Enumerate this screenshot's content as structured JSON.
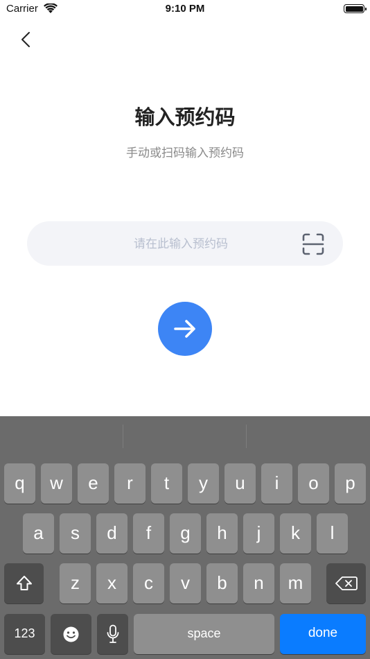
{
  "status_bar": {
    "carrier": "Carrier",
    "time": "9:10 PM"
  },
  "page": {
    "title": "输入预约码",
    "subtitle": "手动或扫码输入预约码",
    "input": {
      "value": "",
      "placeholder": "请在此输入预约码"
    }
  },
  "keyboard": {
    "row1": [
      "q",
      "w",
      "e",
      "r",
      "t",
      "y",
      "u",
      "i",
      "o",
      "p"
    ],
    "row2": [
      "a",
      "s",
      "d",
      "f",
      "g",
      "h",
      "j",
      "k",
      "l"
    ],
    "row3": [
      "z",
      "x",
      "c",
      "v",
      "b",
      "n",
      "m"
    ],
    "numbers_key": "123",
    "space_key": "space",
    "done_key": "done"
  },
  "icons": {
    "back": "chevron-left-icon",
    "scan": "scan-icon",
    "submit": "arrow-right-icon",
    "shift": "shift-icon",
    "delete": "delete-backspace-icon",
    "emoji": "emoji-icon",
    "mic": "microphone-icon",
    "wifi": "wifi-icon",
    "battery": "battery-icon"
  },
  "colors": {
    "accent": "#3d85f5",
    "input_bg": "#f3f4f8",
    "done_key": "#0a7cff"
  }
}
